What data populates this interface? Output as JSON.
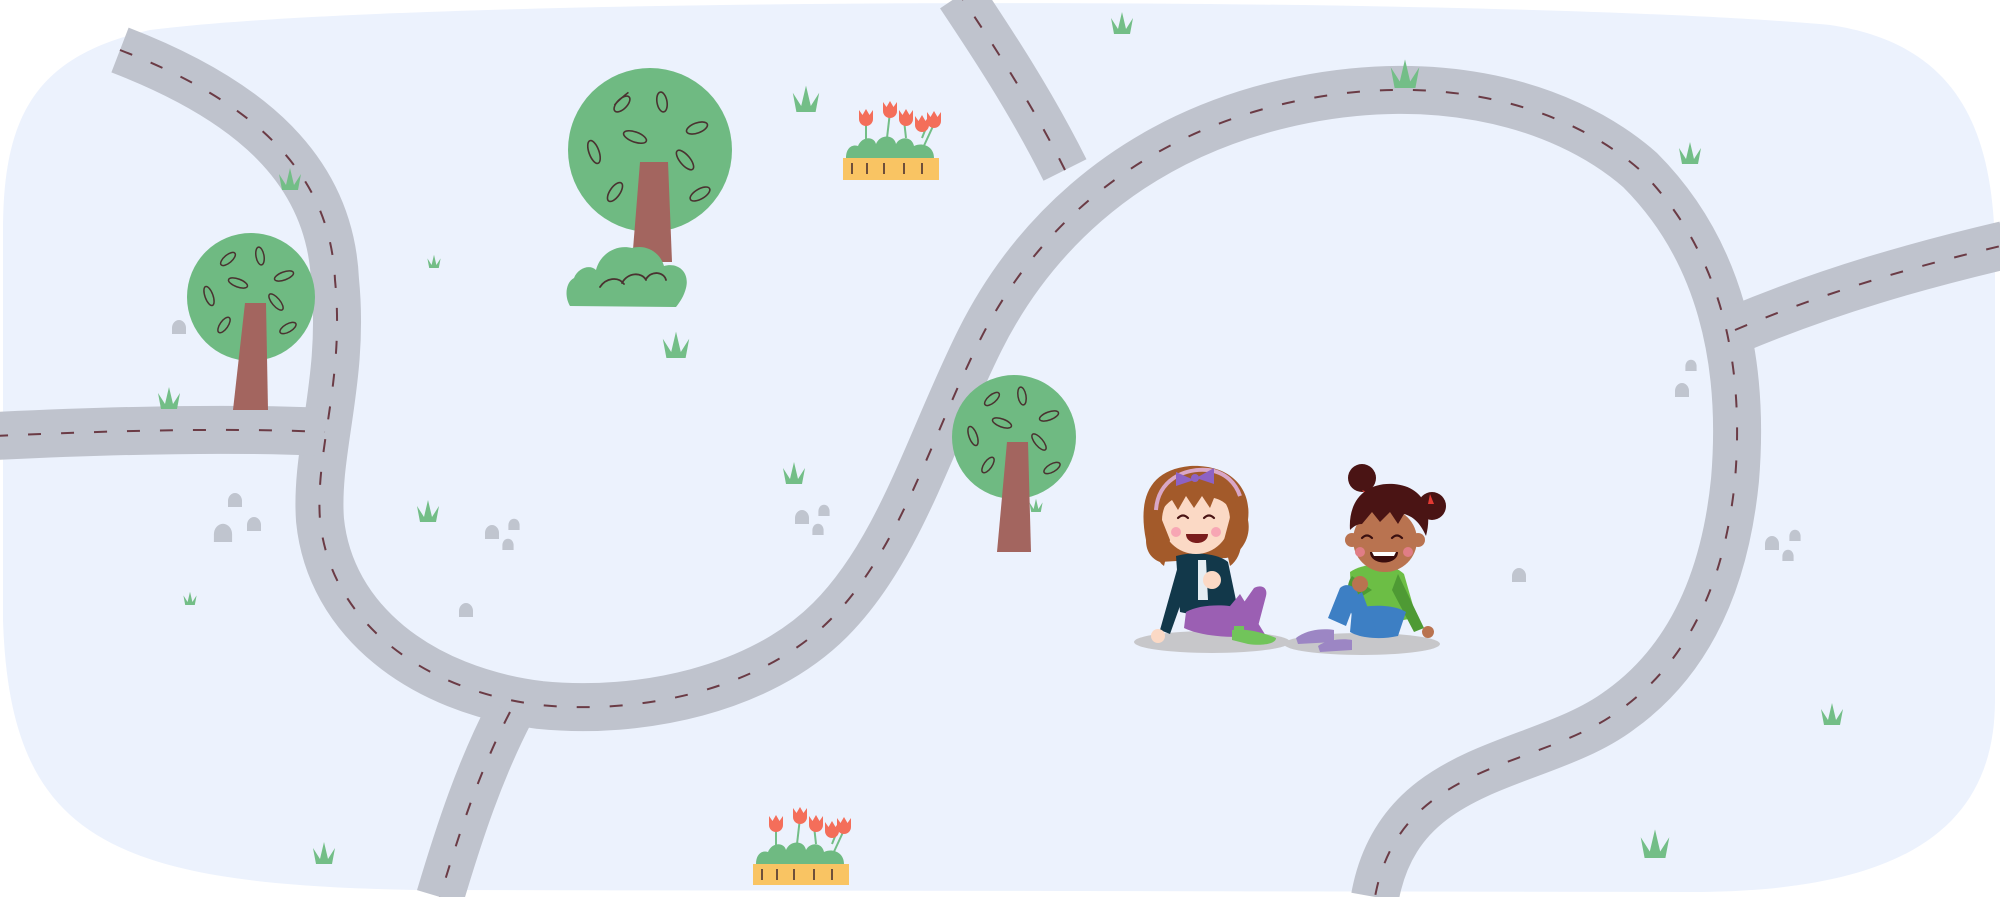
{
  "scene": {
    "kind": "illustration",
    "subject": "cartoon-kids-on-road-map",
    "colors": {
      "page": "#ffffff",
      "ground": "#ecf2fd",
      "road": "#bfc3cd",
      "road_dash": "#6b3b45",
      "foliage": "#6fba82",
      "leaf_outline": "#4a3230",
      "trunk": "#a3655f",
      "grass": "#73be87",
      "rock": "#c0c5cf",
      "planter": "#f9c463",
      "tulip": "#f46e5a",
      "shadow": "#c7c7ca",
      "skin_light": "#fbd9c5",
      "skin_dark": "#b97350",
      "hair_brown": "#a35a2a",
      "hair_dark": "#4a1414",
      "bow": "#8d62c4",
      "jacket": "#12384a",
      "pants_purple": "#9b5fb3",
      "shirt_green": "#6cbe45",
      "jeans": "#3d7fc4",
      "shoes_purple": "#9c86c4",
      "shoes_green": "#71c45a",
      "hairband": "#e43a33"
    },
    "icons": [
      "tree-icon",
      "bush-icon",
      "grass-icon",
      "rock-icon",
      "flower-planter-icon"
    ]
  }
}
